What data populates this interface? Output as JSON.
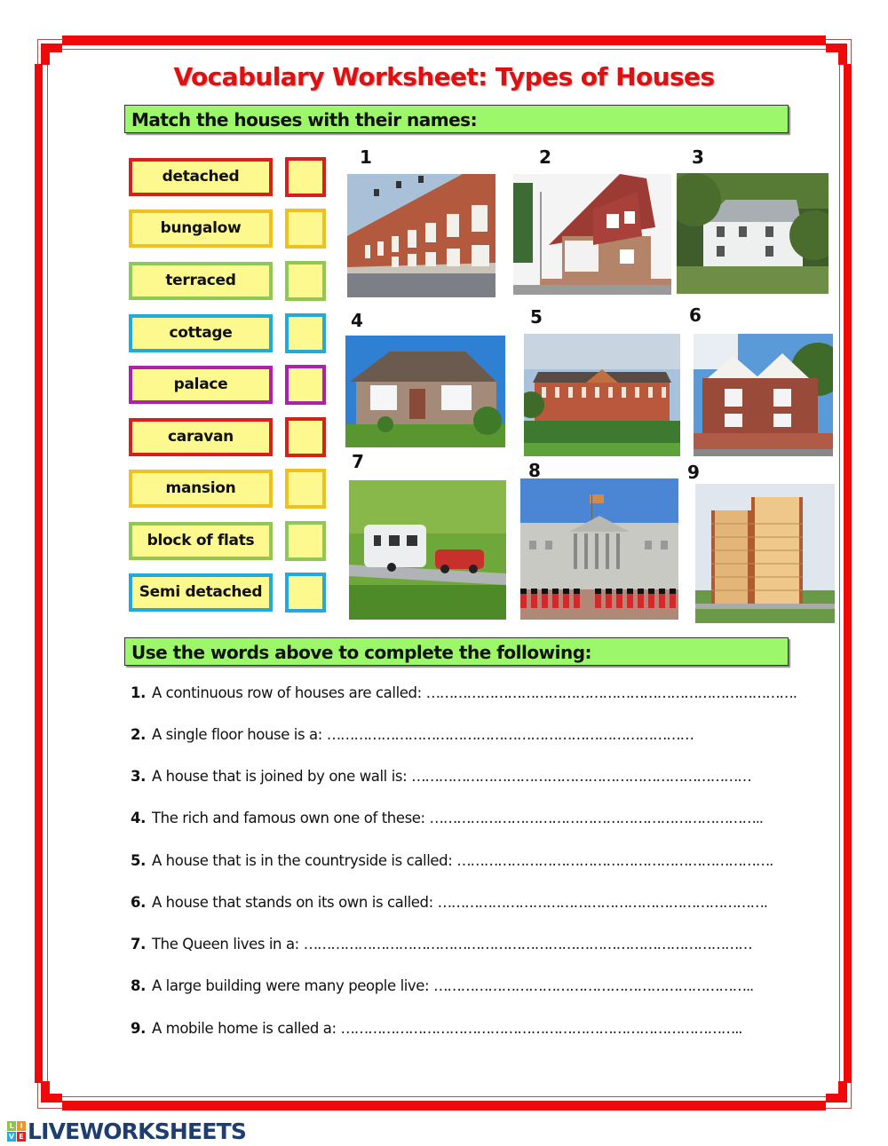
{
  "worksheet": {
    "title": "Vocabulary Worksheet: Types of Houses",
    "frame_color": "#ee0a0a",
    "section1_heading": "Match the houses with their names:",
    "section2_heading": "Use the words above to complete the following:",
    "section_bar_color": "#9cf76b",
    "box_fill_color": "#fdf98f"
  },
  "words": [
    {
      "label": "detached",
      "border_color": "#d8201a",
      "answer": ""
    },
    {
      "label": "bungalow",
      "border_color": "#f0c020",
      "answer": ""
    },
    {
      "label": "terraced",
      "border_color": "#90c858",
      "answer": ""
    },
    {
      "label": "cottage",
      "border_color": "#22aadd",
      "answer": ""
    },
    {
      "label": "palace",
      "border_color": "#b020b0",
      "answer": ""
    },
    {
      "label": "caravan",
      "border_color": "#d8201a",
      "answer": ""
    },
    {
      "label": "mansion",
      "border_color": "#f0c020",
      "answer": ""
    },
    {
      "label": "block of flats",
      "border_color": "#90c858",
      "answer": ""
    },
    {
      "label": "Semi detached",
      "border_color": "#22aadd",
      "answer": ""
    }
  ],
  "pictures": [
    {
      "number": "1",
      "subject": "terraced-houses-photo"
    },
    {
      "number": "2",
      "subject": "detached-house-photo"
    },
    {
      "number": "3",
      "subject": "cottage-photo"
    },
    {
      "number": "4",
      "subject": "bungalow-photo"
    },
    {
      "number": "5",
      "subject": "mansion-photo"
    },
    {
      "number": "6",
      "subject": "semi-detached-house-photo"
    },
    {
      "number": "7",
      "subject": "caravan-photo"
    },
    {
      "number": "8",
      "subject": "palace-photo"
    },
    {
      "number": "9",
      "subject": "block-of-flats-photo"
    }
  ],
  "questions": [
    {
      "number": "1.",
      "text": "A continuous row of houses are called:",
      "blank": "………………………………………………………………………."
    },
    {
      "number": "2.",
      "text": "A single floor house is a:",
      "blank": "………………………………………………………………………"
    },
    {
      "number": "3.",
      "text": "A house that is joined by one wall is:",
      "blank": "…………………………………………………………………"
    },
    {
      "number": "4.",
      "text": "The rich and famous own one of these:",
      "blank": "……………………………………………………………….."
    },
    {
      "number": "5.",
      "text": "A house that is in the countryside is called:",
      "blank": "……………………………………………………………."
    },
    {
      "number": "6.",
      "text": "A house that stands on its own is called:",
      "blank": "………………………………………………………………."
    },
    {
      "number": "7.",
      "text": "The Queen lives in a:",
      "blank": "………………………………………………………………………………………"
    },
    {
      "number": "8.",
      "text": "A large building were many people live:",
      "blank": "…………………………………………………………….."
    },
    {
      "number": "9.",
      "text": "A mobile home is called a:",
      "blank": "…………………………………………………………………………….."
    }
  ],
  "footer": {
    "brand": "LIVEWORKSHEETS",
    "logo_letters": [
      "L",
      "I",
      "V",
      "E"
    ],
    "logo_colors": [
      "#8cc63f",
      "#f7941d",
      "#29abe2",
      "#ed1c24"
    ]
  }
}
